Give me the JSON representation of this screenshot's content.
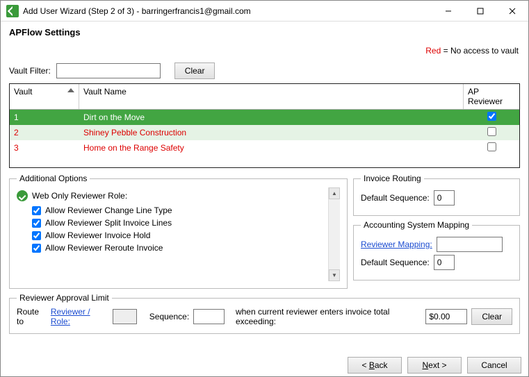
{
  "window": {
    "title": "Add User Wizard (Step 2 of 3) - barringerfrancis1@gmail.com"
  },
  "page": {
    "heading": "APFlow Settings",
    "legend_prefix": "Red",
    "legend_suffix": " = No access to vault"
  },
  "filter": {
    "label": "Vault Filter:",
    "value": "",
    "clear_label": "Clear"
  },
  "grid": {
    "headers": {
      "vault": "Vault",
      "name": "Vault Name",
      "reviewer": "AP Reviewer"
    },
    "rows": [
      {
        "id": "1",
        "name": "Dirt on the Move",
        "reviewer": true,
        "selected": true,
        "no_access": false
      },
      {
        "id": "2",
        "name": "Shiney Pebble Construction",
        "reviewer": false,
        "selected": false,
        "no_access": true,
        "alt": true
      },
      {
        "id": "3",
        "name": "Home on the Range Safety",
        "reviewer": false,
        "selected": false,
        "no_access": true
      }
    ]
  },
  "options": {
    "legend": "Additional Options",
    "role_label": "Web Only Reviewer Role:",
    "items": [
      {
        "label": "Allow Reviewer Change Line Type",
        "checked": true
      },
      {
        "label": "Allow Reviewer Split Invoice Lines",
        "checked": true
      },
      {
        "label": "Allow Reviewer Invoice Hold",
        "checked": true
      },
      {
        "label": "Allow Reviewer Reroute Invoice",
        "checked": true
      }
    ]
  },
  "routing": {
    "legend": "Invoice Routing",
    "default_seq_label": "Default Sequence:",
    "default_seq_value": "0"
  },
  "mapping": {
    "legend": "Accounting System Mapping",
    "reviewer_mapping_label": "Reviewer Mapping:",
    "reviewer_mapping_value": "",
    "default_seq_label": "Default Sequence:",
    "default_seq_value": "0"
  },
  "approval": {
    "legend": "Reviewer Approval Limit",
    "route_to_label": "Route to",
    "reviewer_role_link": "Reviewer / Role:",
    "reviewer_role_value": "",
    "sequence_label": "Sequence:",
    "sequence_value": "",
    "mid_text": "when current reviewer enters invoice total exceeding:",
    "amount_value": "$0.00",
    "clear_label": "Clear"
  },
  "footer": {
    "back_prefix": "< ",
    "back_u": "B",
    "back_rest": "ack",
    "next_u": "N",
    "next_rest": "ext >",
    "cancel": "Cancel"
  }
}
